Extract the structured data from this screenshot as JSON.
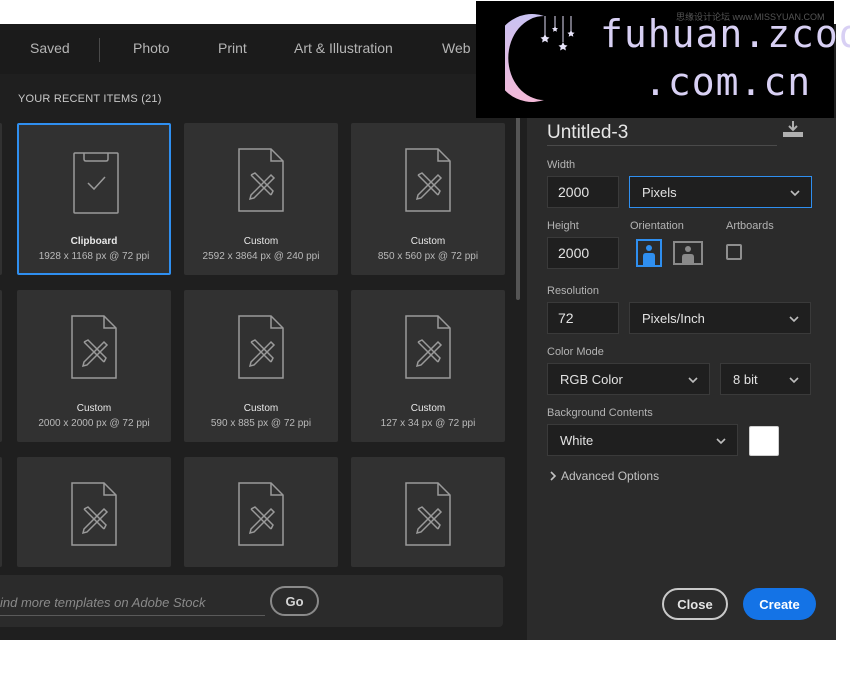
{
  "tabs": [
    "Saved",
    "Photo",
    "Print",
    "Art & Illustration",
    "Web"
  ],
  "recent": {
    "heading": "YOUR RECENT ITEMS",
    "count": "(21)",
    "items": [
      {
        "name": "Clipboard",
        "meta": "1928 x 1168 px @ 72 ppi",
        "icon": "clipboard-doc-icon",
        "selected": true
      },
      {
        "name": "Custom",
        "meta": "2592 x 3864 px @ 240 ppi",
        "icon": "custom-doc-icon"
      },
      {
        "name": "Custom",
        "meta": "850 x 560 px @ 72 ppi",
        "icon": "custom-doc-icon"
      },
      {
        "name": "Custom",
        "meta": "2000 x 2000 px @ 72 ppi",
        "icon": "custom-doc-icon"
      },
      {
        "name": "Custom",
        "meta": "590 x 885 px @ 72 ppi",
        "icon": "custom-doc-icon"
      },
      {
        "name": "Custom",
        "meta": "127 x 34 px @ 72 ppi",
        "icon": "custom-doc-icon"
      },
      {
        "name": "",
        "meta": "",
        "icon": "custom-doc-icon"
      },
      {
        "name": "",
        "meta": "",
        "icon": "custom-doc-icon"
      },
      {
        "name": "",
        "meta": "",
        "icon": "custom-doc-icon"
      }
    ]
  },
  "stock": {
    "placeholder": "ind more templates on Adobe Stock",
    "go_label": "Go"
  },
  "preset": {
    "doc_name": "Untitled-3",
    "width_label": "Width",
    "width_value": "2000",
    "unit_value": "Pixels",
    "height_label": "Height",
    "height_value": "2000",
    "orientation_label": "Orientation",
    "artboards_label": "Artboards",
    "resolution_label": "Resolution",
    "resolution_value": "72",
    "resolution_unit": "Pixels/Inch",
    "color_mode_label": "Color Mode",
    "color_mode_value": "RGB Color",
    "bit_depth_value": "8 bit",
    "bg_label": "Background Contents",
    "bg_value": "White",
    "bg_color": "#ffffff",
    "advanced_label": "Advanced Options",
    "close_label": "Close",
    "create_label": "Create"
  },
  "watermark": {
    "line1": "fuhuan.zcool",
    "line2": ".com.cn",
    "sub": "思缘设计论坛 www.MISSYUAN.COM"
  },
  "colors": {
    "accent": "#1473e6",
    "focus": "#2f8ff0",
    "dialog_bg": "#1f1f1f",
    "panel_bg": "#2b2b2b",
    "card_bg": "#313131"
  }
}
